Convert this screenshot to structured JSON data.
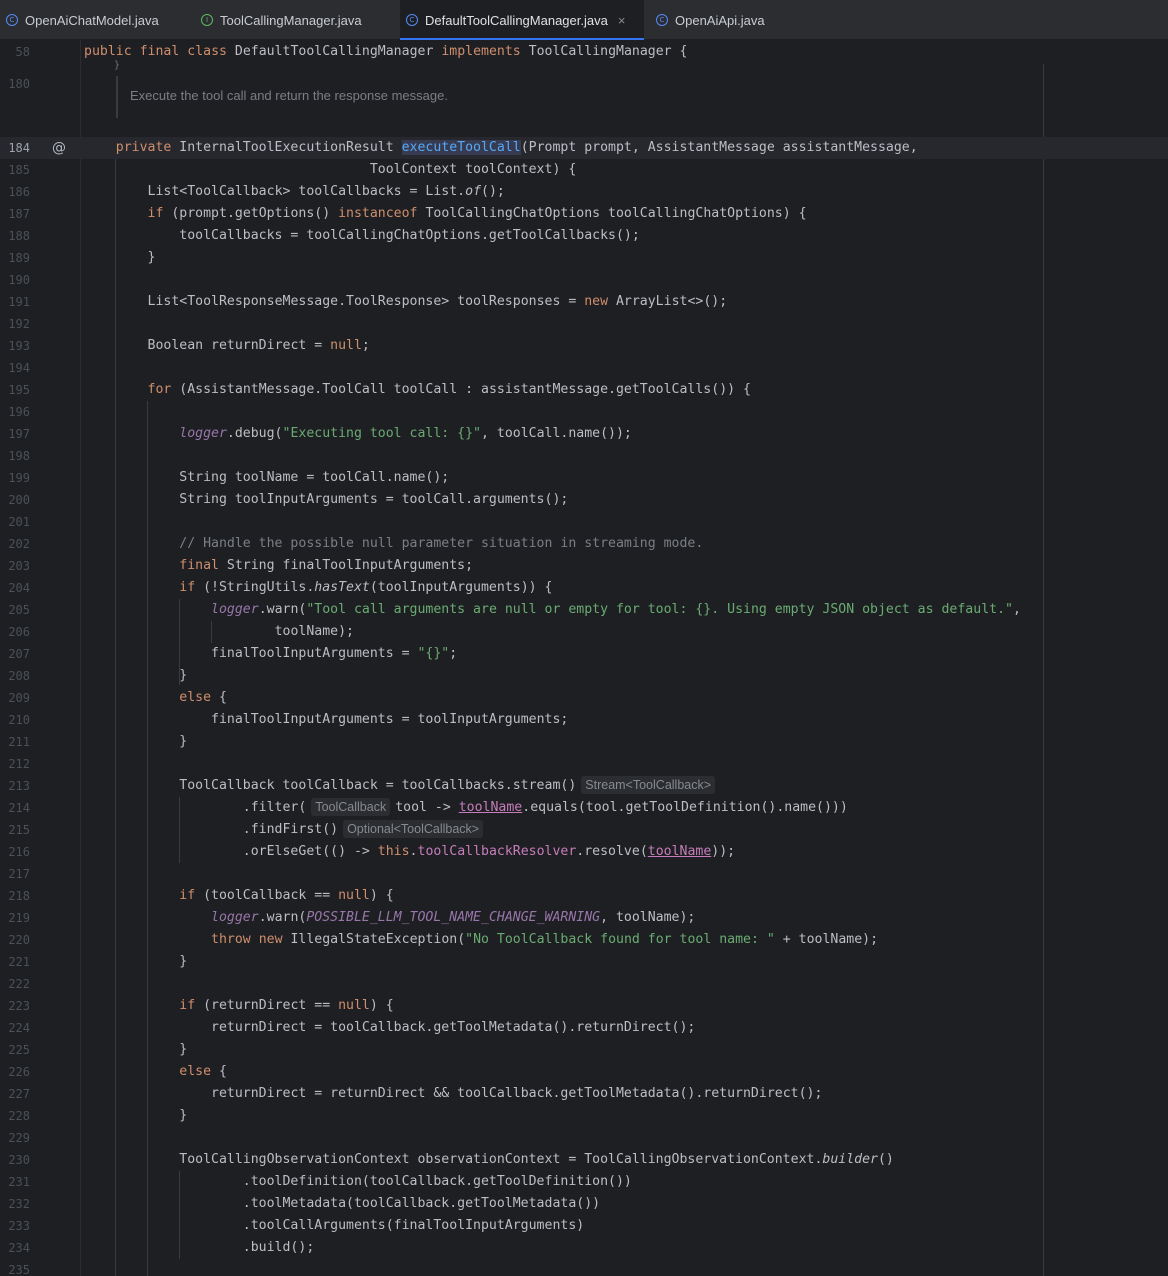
{
  "tabs": [
    {
      "label": "OpenAiChatModel.java",
      "icon": "class-icon",
      "active": false
    },
    {
      "label": "ToolCallingManager.java",
      "icon": "interface-icon",
      "active": false
    },
    {
      "label": "DefaultToolCallingManager.java",
      "icon": "class-icon",
      "active": true
    },
    {
      "label": "OpenAiApi.java",
      "icon": "class-icon",
      "active": false
    }
  ],
  "tab_close_glyph": "×",
  "doc_comment": "Execute the tool call and return the response message.",
  "gutter_icon": "@",
  "line_numbers": [
    "58",
    "180",
    "184",
    "185",
    "186",
    "187",
    "188",
    "189",
    "190",
    "191",
    "192",
    "193",
    "194",
    "195",
    "196",
    "197",
    "198",
    "199",
    "200",
    "201",
    "202",
    "203",
    "204",
    "205",
    "206",
    "207",
    "208",
    "209",
    "210",
    "211",
    "212",
    "213",
    "214",
    "215",
    "216",
    "217",
    "218",
    "219",
    "220",
    "221",
    "222",
    "223",
    "224",
    "225",
    "226",
    "227",
    "228",
    "229",
    "230",
    "231",
    "232",
    "233",
    "234",
    "235"
  ],
  "code": {
    "l58": [
      "public",
      "final",
      "class",
      " DefaultToolCallingManager ",
      "implements",
      " ToolCallingManager {"
    ],
    "l184": [
      "private",
      " InternalToolExecutionResult ",
      "executeToolCall",
      "(Prompt prompt, AssistantMessage assistantMessage,"
    ],
    "l185": "ToolContext toolContext) {",
    "l186": [
      "List<ToolCallback> toolCallbacks = List.",
      "of",
      "();"
    ],
    "l187": [
      "if",
      " (prompt.getOptions() ",
      "instanceof",
      " ToolCallingChatOptions toolCallingChatOptions) {"
    ],
    "l188": "toolCallbacks = toolCallingChatOptions.getToolCallbacks();",
    "l189": "}",
    "l191": [
      "List<ToolResponseMessage.ToolResponse> toolResponses = ",
      "new",
      " ArrayList<>();"
    ],
    "l193": [
      "Boolean returnDirect = ",
      "null",
      ";"
    ],
    "l195": [
      "for",
      " (AssistantMessage.ToolCall toolCall : assistantMessage.getToolCalls()) {"
    ],
    "l197": [
      "logger",
      ".debug(",
      "\"Executing tool call: {}\"",
      ", toolCall.name());"
    ],
    "l199": "String toolName = toolCall.name();",
    "l200": "String toolInputArguments = toolCall.arguments();",
    "l202": "// Handle the possible null parameter situation in streaming mode.",
    "l203": [
      "final",
      " String finalToolInputArguments;"
    ],
    "l204": [
      "if",
      " (!StringUtils.",
      "hasText",
      "(toolInputArguments)) {"
    ],
    "l205": [
      "logger",
      ".warn(",
      "\"Tool call arguments are null or empty for tool: {}. Using empty JSON object as default.\"",
      ","
    ],
    "l206": "toolName);",
    "l207": [
      "finalToolInputArguments = ",
      "\"{}\"",
      ";"
    ],
    "l208": "}",
    "l209": [
      "else",
      " {"
    ],
    "l210": "finalToolInputArguments = toolInputArguments;",
    "l211": "}",
    "l213": [
      "ToolCallback toolCallback = toolCallbacks.stream()",
      "Stream<ToolCallback>"
    ],
    "l214": [
      ".filter(",
      "ToolCallback",
      "tool -> ",
      "toolName",
      ".equals(tool.getToolDefinition().name()))"
    ],
    "l215": [
      ".findFirst()",
      "Optional<ToolCallback>"
    ],
    "l216": [
      ".orElseGet(() -> ",
      "this",
      ".",
      "toolCallbackResolver",
      ".resolve(",
      "toolName",
      "));"
    ],
    "l218": [
      "if",
      " (toolCallback == ",
      "null",
      ") {"
    ],
    "l219": [
      "logger",
      ".warn(",
      "POSSIBLE_LLM_TOOL_NAME_CHANGE_WARNING",
      ", toolName);"
    ],
    "l220": [
      "throw",
      "new",
      " IllegalStateException(",
      "\"No ToolCallback found for tool name: \"",
      " + toolName);"
    ],
    "l221": "}",
    "l223": [
      "if",
      " (returnDirect == ",
      "null",
      ") {"
    ],
    "l224": "returnDirect = toolCallback.getToolMetadata().returnDirect();",
    "l225": "}",
    "l226": [
      "else",
      " {"
    ],
    "l227": "returnDirect = returnDirect && toolCallback.getToolMetadata().returnDirect();",
    "l228": "}",
    "l230": [
      "ToolCallingObservationContext observationContext = ToolCallingObservationContext.",
      "builder",
      "()"
    ],
    "l231": ".toolDefinition(toolCallback.getToolDefinition())",
    "l232": ".toolMetadata(toolCallback.getToolMetadata())",
    "l233": ".toolCallArguments(finalToolInputArguments)",
    "l234": ".build();"
  }
}
